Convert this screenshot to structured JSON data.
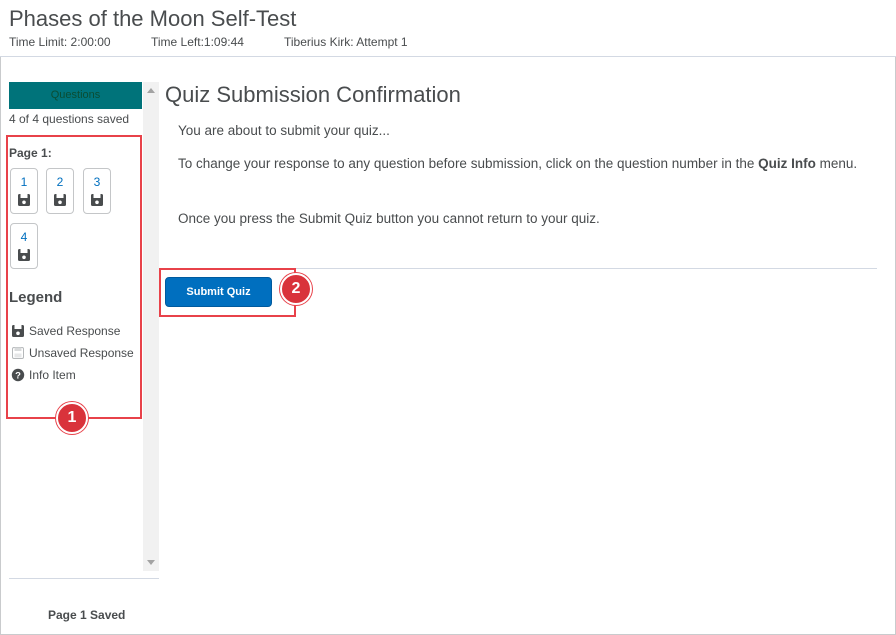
{
  "header": {
    "title": "Phases of the Moon Self-Test",
    "time_limit": "Time Limit: 2:00:00",
    "time_left": "Time Left:1:09:44",
    "attempt": "Tiberius Kirk: Attempt 1"
  },
  "sidebar": {
    "questions_button": "Questions",
    "saved_count": "4 of 4 questions saved",
    "page_label": "Page 1:",
    "questions": [
      {
        "number": "1",
        "status": "saved"
      },
      {
        "number": "2",
        "status": "saved"
      },
      {
        "number": "3",
        "status": "saved"
      },
      {
        "number": "4",
        "status": "saved"
      }
    ],
    "legend_title": "Legend",
    "legend": [
      {
        "label": "Saved Response",
        "icon": "disk-icon"
      },
      {
        "label": "Unsaved Response",
        "icon": "disk-outline-icon"
      },
      {
        "label": "Info Item",
        "icon": "question-icon"
      }
    ],
    "page_saved": "Page 1 Saved"
  },
  "main": {
    "title": "Quiz Submission Confirmation",
    "line1": "You are about to submit your quiz...",
    "line2_pre": "To change your response to any question before submission, click on the question number in the ",
    "line2_bold": "Quiz Info",
    "line2_post": " menu.",
    "line3": "Once you press the Submit Quiz button you cannot return to your quiz.",
    "submit_label": "Submit Quiz"
  },
  "annotations": {
    "badge1": "1",
    "badge2": "2"
  },
  "colors": {
    "questions_button": "#00737a",
    "submit_button": "#006fbf",
    "callout": "#e8424a",
    "link": "#006fbf"
  }
}
